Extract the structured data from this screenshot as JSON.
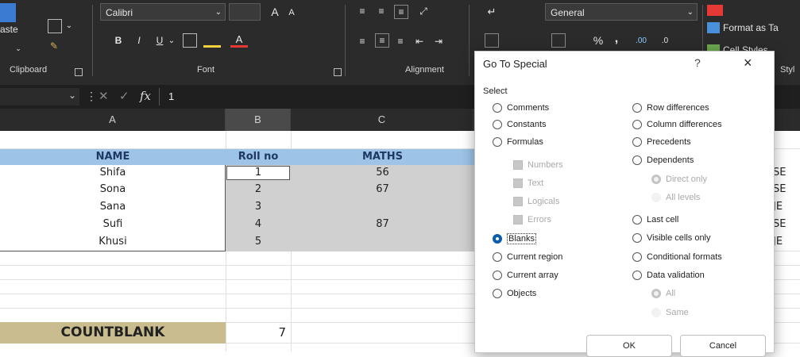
{
  "ribbon": {
    "paste_label": "aste",
    "clipboard_label": "Clipboard",
    "font_name": "Calibri",
    "font_label": "Font",
    "alignment_label": "Alignment",
    "number_format": "General",
    "format_as_table": "Format as Ta",
    "cell_styles": "Cell Styles",
    "styles_label": "Styl",
    "grow_font": "A",
    "shrink_font": "A",
    "bold": "B",
    "italic": "I",
    "underline": "U",
    "percent": "%",
    "comma": ","
  },
  "formula_bar": {
    "fx": "fx",
    "content": "1"
  },
  "columns": [
    "A",
    "B",
    "C"
  ],
  "table": {
    "headers": [
      "NAME",
      "Roll no",
      "MATHS"
    ],
    "rows": [
      [
        "Shifa",
        "1",
        "56"
      ],
      [
        "Sona",
        "2",
        "67"
      ],
      [
        "Sana",
        "3",
        ""
      ],
      [
        "Sufi",
        "4",
        "87"
      ],
      [
        "Khusi",
        "5",
        ""
      ]
    ],
    "right_fragments": [
      "SE",
      "SE",
      "JE",
      "SE",
      "JE"
    ]
  },
  "countblank": {
    "label": "COUNTBLANK",
    "value": "7"
  },
  "dialog": {
    "title": "Go To Special",
    "help": "?",
    "close": "×",
    "select_label": "Select",
    "left_options": [
      "Comments",
      "Constants",
      "Formulas"
    ],
    "formula_subs": [
      "Numbers",
      "Text",
      "Logicals",
      "Errors"
    ],
    "left_options2": [
      "Blanks",
      "Current region",
      "Current array",
      "Objects"
    ],
    "right_options": [
      "Row differences",
      "Column differences",
      "Precedents",
      "Dependents"
    ],
    "dependents_subs": [
      "Direct only",
      "All levels"
    ],
    "right_options2": [
      "Last cell",
      "Visible cells only",
      "Conditional formats",
      "Data validation"
    ],
    "validation_subs": [
      "All",
      "Same"
    ],
    "ok": "OK",
    "cancel": "Cancel"
  },
  "colors": {
    "ribbon_bg": "#2b2b2b",
    "header_fill": "#9dc3e6",
    "selected_fill": "#d0d0d0",
    "countblank_fill": "#c9bd8f",
    "accent": "#0b5cad"
  }
}
